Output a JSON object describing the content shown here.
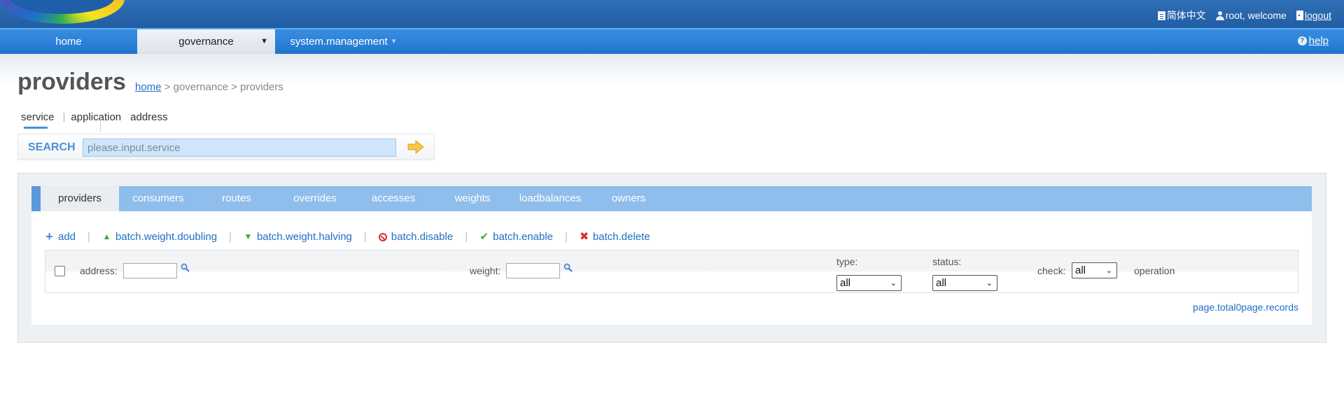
{
  "header": {
    "lang_label": "简体中文",
    "welcome_label": "root, welcome",
    "logout_label": "logout"
  },
  "nav": {
    "home": "home",
    "governance": "governance",
    "system_management": "system.management",
    "help": "help"
  },
  "page": {
    "title": "providers",
    "breadcrumb_home": "home",
    "breadcrumb_rest": " > governance > providers"
  },
  "subtabs": [
    "service",
    "application",
    "address"
  ],
  "search": {
    "label": "SEARCH",
    "placeholder": "please.input.service"
  },
  "tabs": [
    "providers",
    "consumers",
    "routes",
    "overrides",
    "accesses",
    "weights",
    "loadbalances",
    "owners"
  ],
  "actions": {
    "add": "add",
    "doubling": "batch.weight.doubling",
    "halving": "batch.weight.halving",
    "disable": "batch.disable",
    "enable": "batch.enable",
    "delete": "batch.delete"
  },
  "filter": {
    "address_label": "address:",
    "weight_label": "weight:",
    "type_label": "type:",
    "type_value": "all",
    "status_label": "status:",
    "status_value": "all",
    "check_label": "check:",
    "check_value": "all",
    "operation_label": "operation"
  },
  "pager": "page.total0page.records",
  "colors": {
    "header": "#215da3",
    "nav": "#1f74cf",
    "tabs": "#8fbdec",
    "link": "#1f6fc4"
  }
}
